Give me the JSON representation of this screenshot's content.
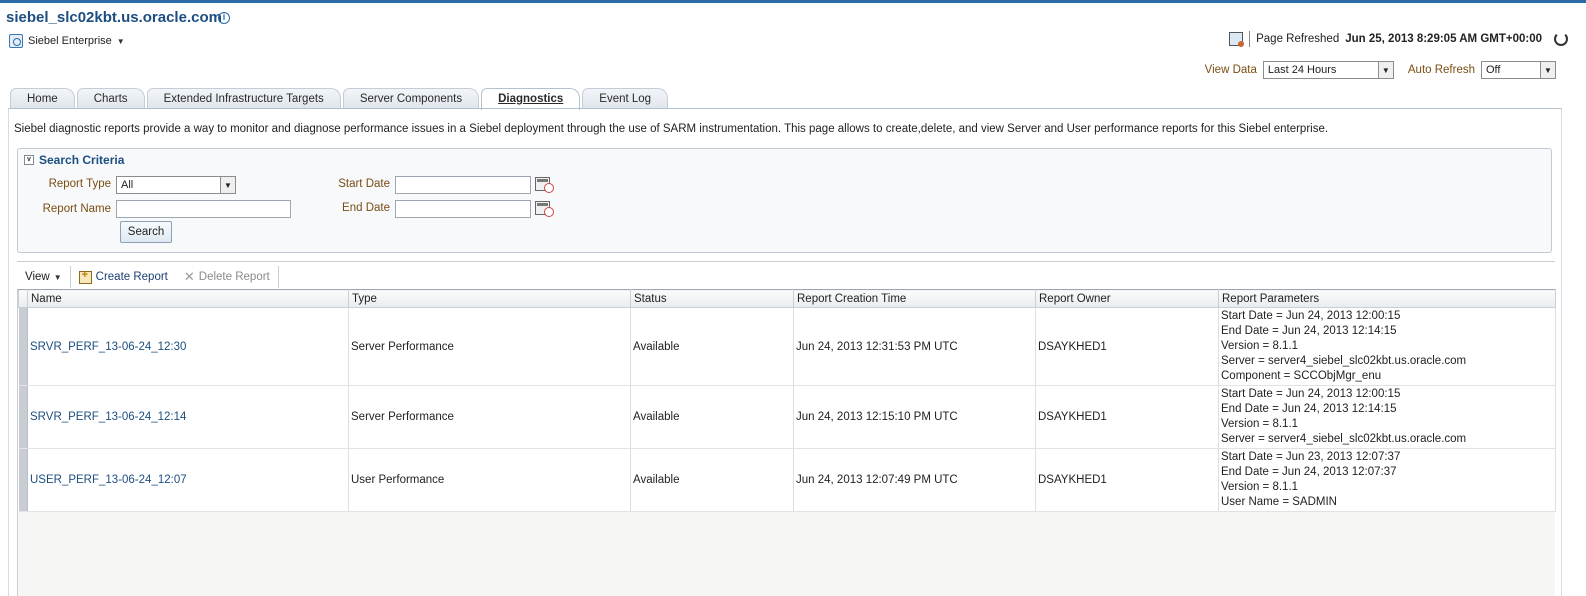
{
  "header": {
    "target_name": "siebel_slc02kbt.us.oracle.com",
    "menu_label": "Siebel Enterprise",
    "page_refreshed_label": "Page Refreshed",
    "page_refreshed_time": "Jun 25, 2013 8:29:05 AM GMT+00:00"
  },
  "controls": {
    "view_data_label": "View Data",
    "view_data_value": "Last 24 Hours",
    "auto_refresh_label": "Auto Refresh",
    "auto_refresh_value": "Off"
  },
  "tabs": [
    {
      "label": "Home"
    },
    {
      "label": "Charts"
    },
    {
      "label": "Extended Infrastructure Targets"
    },
    {
      "label": "Server Components"
    },
    {
      "label": "Diagnostics",
      "active": true
    },
    {
      "label": "Event Log"
    }
  ],
  "description": "Siebel diagnostic reports provide a way to monitor and diagnose performance issues in a Siebel deployment through the use of SARM instrumentation. This page allows to create,delete, and view Server and User performance reports for this Siebel enterprise.",
  "search": {
    "title": "Search Criteria",
    "report_type_label": "Report Type",
    "report_type_value": "All",
    "report_name_label": "Report Name",
    "report_name_value": "",
    "start_date_label": "Start Date",
    "start_date_value": "",
    "end_date_label": "End Date",
    "end_date_value": "",
    "search_button": "Search"
  },
  "toolbar": {
    "view_label": "View",
    "create_label": "Create Report",
    "delete_label": "Delete Report"
  },
  "table": {
    "columns": [
      "Name",
      "Type",
      "Status",
      "Report Creation Time",
      "Report Owner",
      "Report Parameters"
    ],
    "rows": [
      {
        "name": "SRVR_PERF_13-06-24_12:30",
        "type": "Server Performance",
        "status": "Available",
        "created": "Jun 24, 2013 12:31:53 PM UTC",
        "owner": "DSAYKHED1",
        "params": [
          "Start Date = Jun 24, 2013 12:00:15",
          "End Date = Jun 24, 2013 12:14:15",
          "Version = 8.1.1",
          "Server = server4_siebel_slc02kbt.us.oracle.com",
          "Component = SCCObjMgr_enu"
        ]
      },
      {
        "name": "SRVR_PERF_13-06-24_12:14",
        "type": "Server Performance",
        "status": "Available",
        "created": "Jun 24, 2013 12:15:10 PM UTC",
        "owner": "DSAYKHED1",
        "params": [
          "Start Date = Jun 24, 2013 12:00:15",
          "End Date = Jun 24, 2013 12:14:15",
          "Version = 8.1.1",
          "Server = server4_siebel_slc02kbt.us.oracle.com"
        ]
      },
      {
        "name": "USER_PERF_13-06-24_12:07",
        "type": "User Performance",
        "status": "Available",
        "created": "Jun 24, 2013 12:07:49 PM UTC",
        "owner": "DSAYKHED1",
        "params": [
          "Start Date = Jun 23, 2013 12:07:37",
          "End Date = Jun 24, 2013 12:07:37",
          "Version = 8.1.1",
          "User Name = SADMIN"
        ]
      }
    ]
  }
}
